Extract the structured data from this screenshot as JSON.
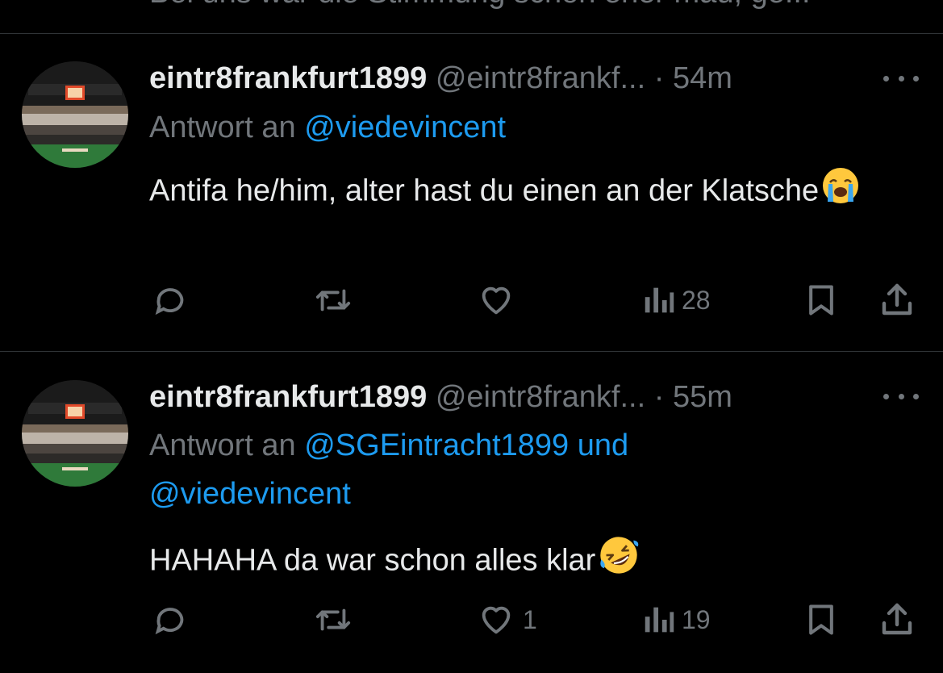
{
  "previous_tweet": {
    "text_fragment": "Bei uns war die Stimmung schon eher mau, ge..."
  },
  "tweets": [
    {
      "name": "eintr8frankfurt1899",
      "handle": "@eintr8frankf...",
      "dot": "·",
      "time": "54m",
      "reply_prefix": "Antwort an",
      "reply_mentions": "@viedevincent",
      "reply_mentions_2": "",
      "text": "Antifa he/him, alter hast du einen an der Klatsche",
      "emoji": "loudly-crying-face-emoji",
      "actions": {
        "reply_count": "",
        "retweet_count": "",
        "like_count": "",
        "views_count": "28"
      }
    },
    {
      "name": "eintr8frankfurt1899",
      "handle": "@eintr8frankf...",
      "dot": "·",
      "time": "55m",
      "reply_prefix": "Antwort an",
      "reply_mentions": "@SGEintracht1899 und",
      "reply_mentions_2": "@viedevincent",
      "text": "HAHAHA da war schon alles klar",
      "emoji": "rolling-on-the-floor-laughing-emoji",
      "actions": {
        "reply_count": "",
        "retweet_count": "",
        "like_count": "1",
        "views_count": "19"
      }
    }
  ],
  "colors": {
    "background": "#000000",
    "primary_text": "#e7e9ea",
    "secondary_text": "#71767b",
    "accent": "#1d9bf0",
    "divider": "#2f3336"
  },
  "icons": [
    "reply-icon",
    "retweet-icon",
    "like-icon",
    "views-icon",
    "bookmark-icon",
    "share-icon",
    "more-icon"
  ]
}
